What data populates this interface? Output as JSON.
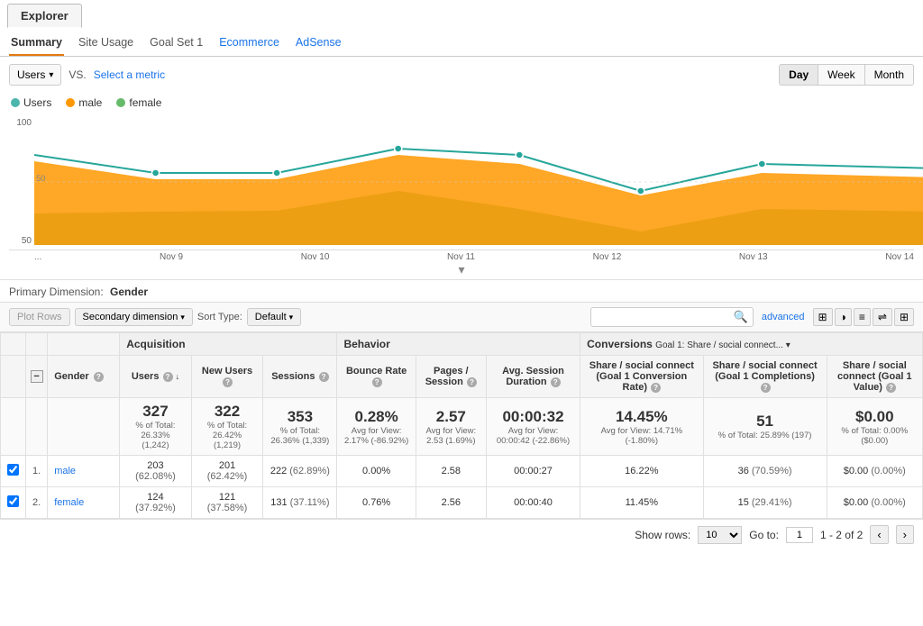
{
  "explorer": {
    "tab_label": "Explorer"
  },
  "tabs": [
    {
      "id": "summary",
      "label": "Summary",
      "active": true
    },
    {
      "id": "site_usage",
      "label": "Site Usage",
      "active": false
    },
    {
      "id": "goal_set_1",
      "label": "Goal Set 1",
      "active": false
    },
    {
      "id": "ecommerce",
      "label": "Ecommerce",
      "active": false,
      "linked": true
    },
    {
      "id": "adsense",
      "label": "AdSense",
      "active": false,
      "linked": true
    }
  ],
  "controls": {
    "metric_dropdown": "Users",
    "vs_text": "VS.",
    "select_metric_label": "Select a metric",
    "time_buttons": [
      "Day",
      "Week",
      "Month"
    ],
    "active_time": "Day"
  },
  "legend": [
    {
      "id": "users",
      "label": "Users",
      "color": "#4db6ac"
    },
    {
      "id": "male",
      "label": "male",
      "color": "#ff9800"
    },
    {
      "id": "female",
      "label": "female",
      "color": "#66bb6a"
    }
  ],
  "chart": {
    "y_labels": [
      "100",
      "50",
      ""
    ],
    "x_labels": [
      "...",
      "Nov 9",
      "Nov 10",
      "Nov 11",
      "Nov 12",
      "Nov 13",
      "Nov 14"
    ]
  },
  "primary_dimension": {
    "label": "Primary Dimension:",
    "value": "Gender"
  },
  "toolbar": {
    "plot_rows_label": "Plot Rows",
    "secondary_dimension_label": "Secondary dimension",
    "sort_type_label": "Sort Type:",
    "default_label": "Default",
    "search_placeholder": "",
    "advanced_label": "advanced"
  },
  "table": {
    "col_groups": [
      {
        "id": "acquisition",
        "label": "Acquisition",
        "span": 3
      },
      {
        "id": "behavior",
        "label": "Behavior",
        "span": 3
      },
      {
        "id": "conversions",
        "label": "Conversions",
        "span": 3,
        "goal_label": "Goal 1: Share / social connect..."
      }
    ],
    "headers": [
      {
        "id": "gender",
        "label": "Gender",
        "info": true,
        "sort": false
      },
      {
        "id": "users",
        "label": "Users",
        "info": true,
        "sort": true
      },
      {
        "id": "new_users",
        "label": "New Users",
        "info": true,
        "sort": false
      },
      {
        "id": "sessions",
        "label": "Sessions",
        "info": true,
        "sort": false
      },
      {
        "id": "bounce_rate",
        "label": "Bounce Rate",
        "info": true,
        "sort": false
      },
      {
        "id": "pages_session",
        "label": "Pages / Session",
        "info": true,
        "sort": false
      },
      {
        "id": "avg_session",
        "label": "Avg. Session Duration",
        "info": true,
        "sort": false
      },
      {
        "id": "share_social_rate",
        "label": "Share / social connect (Goal 1 Conversion Rate)",
        "info": true,
        "sort": false
      },
      {
        "id": "share_social_completions",
        "label": "Share / social connect (Goal 1 Completions)",
        "info": true,
        "sort": false
      },
      {
        "id": "share_social_value",
        "label": "Share / social connect (Goal 1 Value)",
        "info": true,
        "sort": false
      }
    ],
    "totals": {
      "users": "327",
      "users_sub": "% of Total: 26.33% (1,242)",
      "new_users": "322",
      "new_users_sub": "% of Total: 26.42% (1,219)",
      "sessions": "353",
      "sessions_sub": "% of Total: 26.36% (1,339)",
      "bounce_rate": "0.28%",
      "bounce_rate_sub": "Avg for View: 2.17% (-86.92%)",
      "pages_session": "2.57",
      "pages_session_sub": "Avg for View: 2.53 (1.69%)",
      "avg_session": "00:00:32",
      "avg_session_sub": "Avg for View: 00:00:42 (-22.86%)",
      "share_social_rate": "14.45%",
      "share_social_rate_sub": "Avg for View: 14.71% (-1.80%)",
      "share_social_completions": "51",
      "share_social_completions_sub": "% of Total: 25.89% (197)",
      "share_social_value": "$0.00",
      "share_social_value_sub": "% of Total: 0.00% ($0.00)"
    },
    "rows": [
      {
        "rank": "1",
        "gender": "male",
        "checked": true,
        "users": "203",
        "users_pct": "(62.08%)",
        "new_users": "201",
        "new_users_pct": "(62.42%)",
        "sessions": "222",
        "sessions_pct": "(62.89%)",
        "bounce_rate": "0.00%",
        "pages_session": "2.58",
        "avg_session": "00:00:27",
        "share_social_rate": "16.22%",
        "share_social_completions": "36",
        "share_social_completions_pct": "(70.59%)",
        "share_social_value": "$0.00",
        "share_social_value_pct": "(0.00%)"
      },
      {
        "rank": "2",
        "gender": "female",
        "checked": true,
        "users": "124",
        "users_pct": "(37.92%)",
        "new_users": "121",
        "new_users_pct": "(37.58%)",
        "sessions": "131",
        "sessions_pct": "(37.11%)",
        "bounce_rate": "0.76%",
        "pages_session": "2.56",
        "avg_session": "00:00:40",
        "share_social_rate": "11.45%",
        "share_social_completions": "15",
        "share_social_completions_pct": "(29.41%)",
        "share_social_value": "$0.00",
        "share_social_value_pct": "(0.00%)"
      }
    ]
  },
  "pagination": {
    "show_rows_label": "Show rows:",
    "show_rows_value": "10",
    "go_to_label": "Go to:",
    "go_to_value": "1",
    "page_info": "1 - 2 of 2",
    "prev_label": "‹",
    "next_label": "›"
  }
}
